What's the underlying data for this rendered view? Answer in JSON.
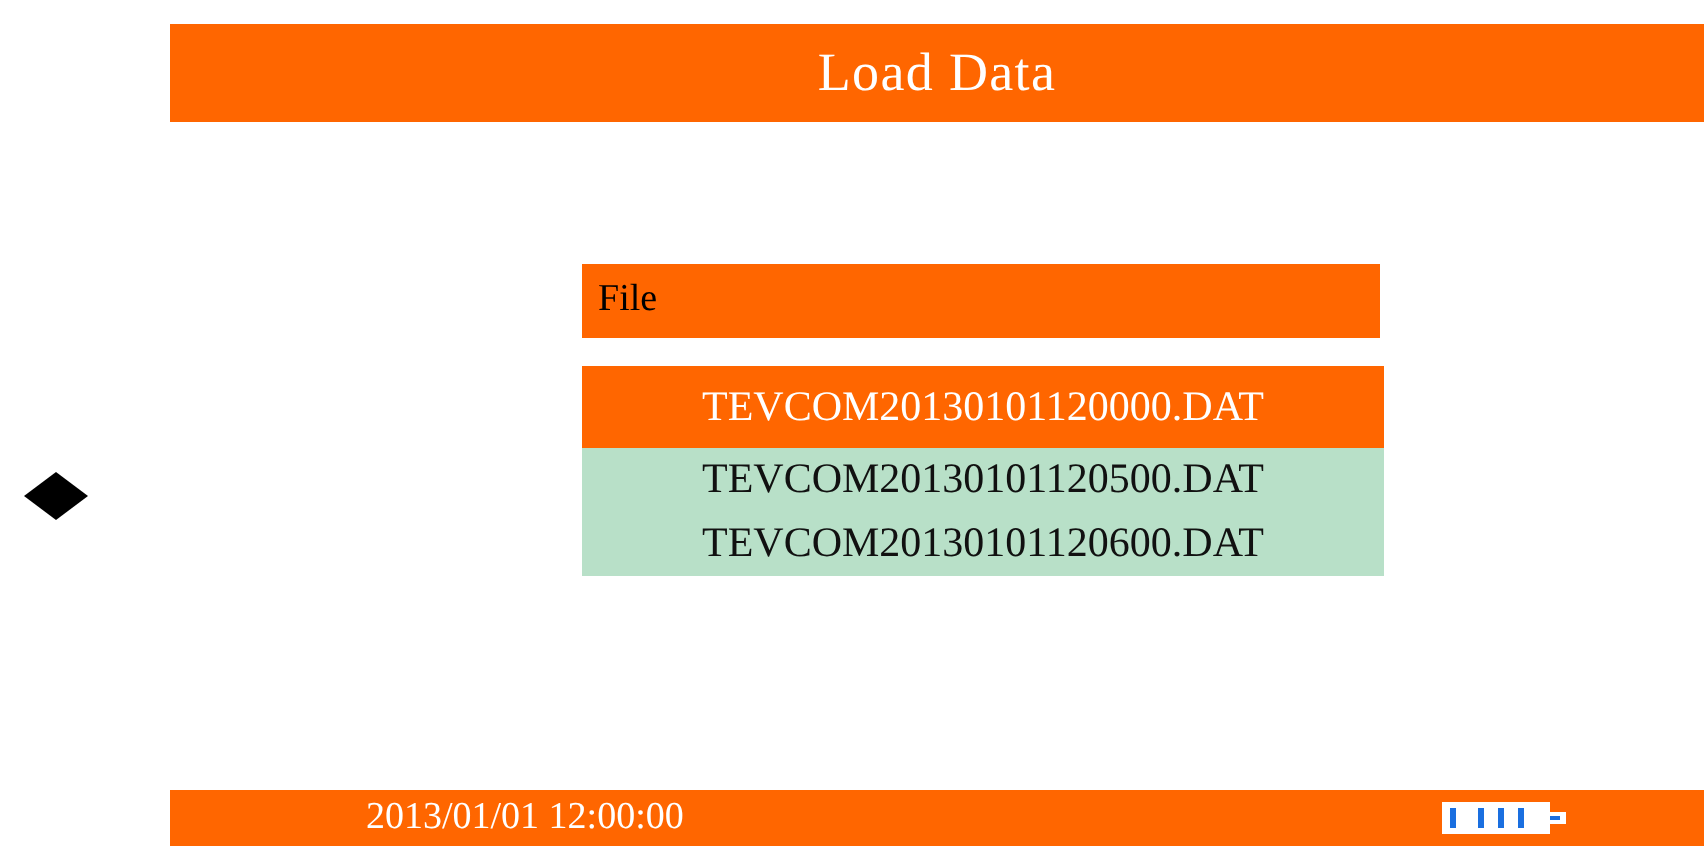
{
  "header": {
    "title": "Load Data"
  },
  "file_list": {
    "heading": "File",
    "files": [
      {
        "name": "TEVCOM20130101120000.DAT",
        "selected": true
      },
      {
        "name": "TEVCOM20130101120500.DAT",
        "selected": false
      },
      {
        "name": "TEVCOM20130101120600.DAT",
        "selected": false
      }
    ]
  },
  "status_bar": {
    "datetime": "2013/01/01 12:00:00"
  }
}
